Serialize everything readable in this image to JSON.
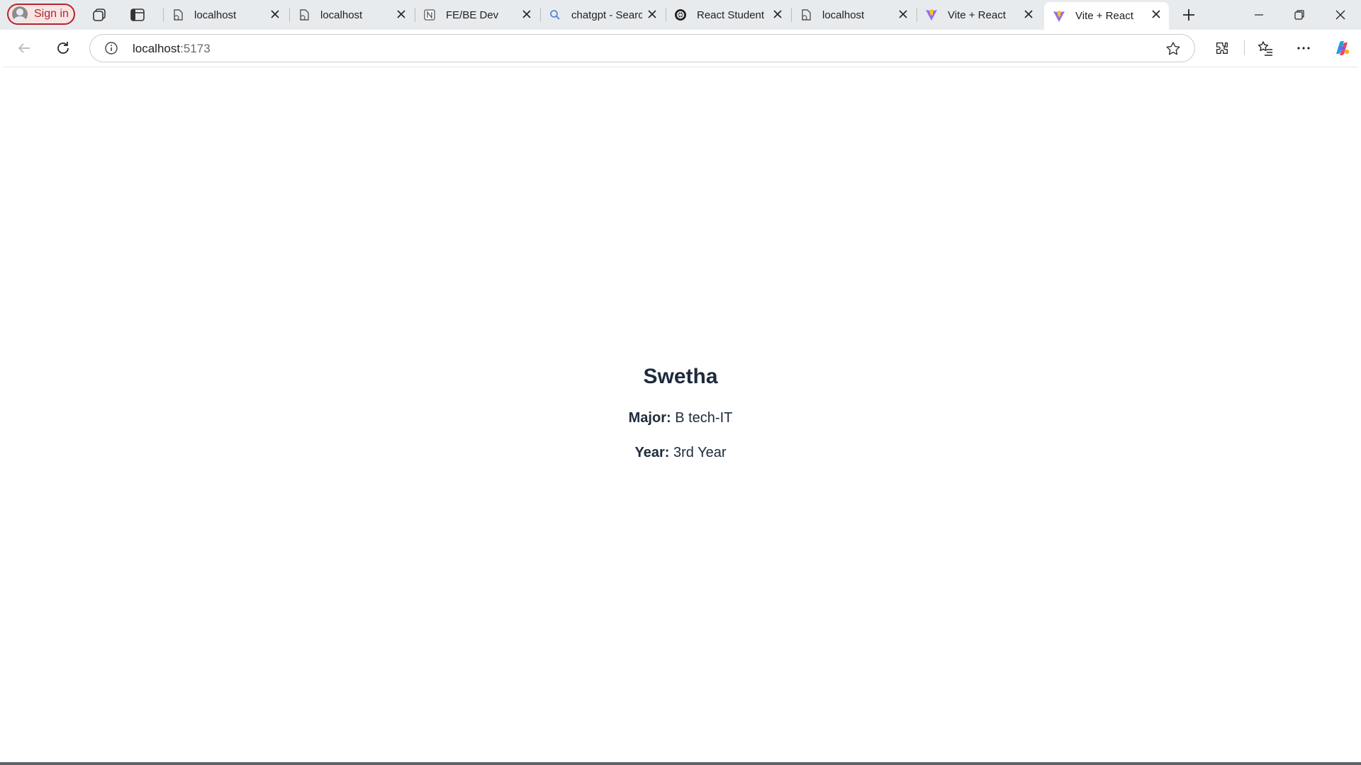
{
  "browser": {
    "signin_label": "Sign in",
    "tabs": [
      {
        "title": "localhost",
        "favicon": "page-icon",
        "active": false
      },
      {
        "title": "localhost",
        "favicon": "page-icon",
        "active": false
      },
      {
        "title": "FE/BE Dev",
        "favicon": "notion-icon",
        "active": false
      },
      {
        "title": "chatgpt - Search",
        "favicon": "search-icon",
        "active": false
      },
      {
        "title": "React Student Management",
        "favicon": "openai-icon",
        "active": false
      },
      {
        "title": "localhost",
        "favicon": "page-icon",
        "active": false
      },
      {
        "title": "Vite + React",
        "favicon": "vite-icon",
        "active": false
      },
      {
        "title": "Vite + React",
        "favicon": "vite-icon",
        "active": true
      }
    ],
    "address": {
      "host": "localhost",
      "port": ":5173"
    },
    "accent_color": "#b3262c"
  },
  "student": {
    "name": "Swetha",
    "major_label": "Major:",
    "major_value": "B tech-IT",
    "year_label": "Year:",
    "year_value": "3rd Year"
  }
}
